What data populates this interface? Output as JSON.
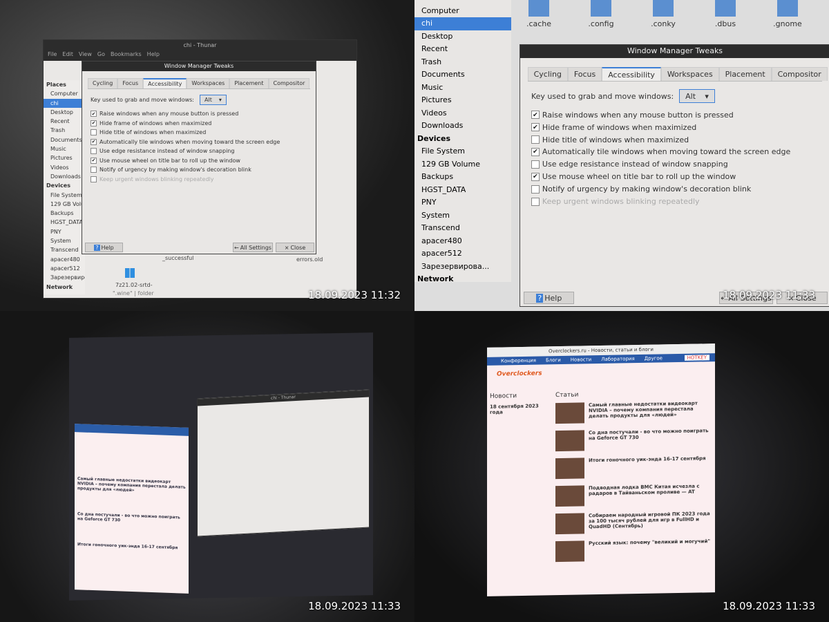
{
  "timestamps": [
    "18.09.2023 11:32",
    "18.09.2023 11:33",
    "18.09.2023 11:33",
    "18.09.2023 11:33"
  ],
  "thunar": {
    "title": "chi - Thunar",
    "menu": [
      "File",
      "Edit",
      "View",
      "Go",
      "Bookmarks",
      "Help"
    ],
    "places_header": "Places",
    "places": [
      "Computer",
      "chi",
      "Desktop",
      "Recent",
      "Trash",
      "Documents",
      "Music",
      "Pictures",
      "Videos",
      "Downloads"
    ],
    "devices_header": "Devices",
    "devices": [
      "File System",
      "129 GB Volume",
      "Backups",
      "HGST_DATA",
      "PNY",
      "System",
      "Transcend",
      "apacer480",
      "apacer512",
      "Зарезервирова..."
    ],
    "network_header": "Network",
    "folders": [
      ".cache",
      ".config",
      ".conky",
      ".dbus",
      ".gnome"
    ],
    "files_visible": [
      "_successful",
      "errors.old",
      "7z21.02-srtd-"
    ],
    "status": "\".wine\"  |  folder"
  },
  "dialog": {
    "title": "Window Manager Tweaks",
    "tabs": [
      "Cycling",
      "Focus",
      "Accessibility",
      "Workspaces",
      "Placement",
      "Compositor"
    ],
    "active_tab": "Accessibility",
    "key_label": "Key used to grab and move windows:",
    "key_value": "Alt",
    "options": [
      {
        "label": "Raise windows when any mouse button is pressed",
        "checked": true,
        "enabled": true
      },
      {
        "label": "Hide frame of windows when maximized",
        "checked": true,
        "enabled": true
      },
      {
        "label": "Hide title of windows when maximized",
        "checked": false,
        "enabled": true
      },
      {
        "label": "Automatically tile windows when moving toward the screen edge",
        "checked": true,
        "enabled": true
      },
      {
        "label": "Use edge resistance instead of window snapping",
        "checked": false,
        "enabled": true
      },
      {
        "label": "Use mouse wheel on title bar to roll up the window",
        "checked": true,
        "enabled": true
      },
      {
        "label": "Notify of urgency by making window's decoration blink",
        "checked": false,
        "enabled": true
      },
      {
        "label": "Keep urgent windows blinking repeatedly",
        "checked": false,
        "enabled": false
      }
    ],
    "help": "Help",
    "all_settings": "All Settings",
    "close": "Close"
  },
  "browser": {
    "title": "Overclockers.ru - Новости, статьи и блоги",
    "nav": [
      "Конференция",
      "Блоги",
      "Новости",
      "Лаборатория",
      "Другое"
    ],
    "hotkey": "HOTKEY",
    "news_header": "Новости",
    "news_date": "18 сентября 2023 года",
    "articles_header": "Статьи",
    "articles": [
      "Самый главные недостатки видеокарт NVIDIA – почему компания перестала делать продукты для «людей»",
      "Со дна постучали - во что можно поиграть на Geforce GT 730",
      "Итоги гоночного уик-энда 16-17 сентября",
      "Подводная лодка ВМС Китая исчезла с радаров в Тайваньском проливе — AT",
      "Собираем народный игровой ПК 2023 года за 100 тысяч рублей для игр в FullHD и QuadHD (Сентябрь)",
      "Русский язык: почему \"великий и могучий\""
    ]
  }
}
